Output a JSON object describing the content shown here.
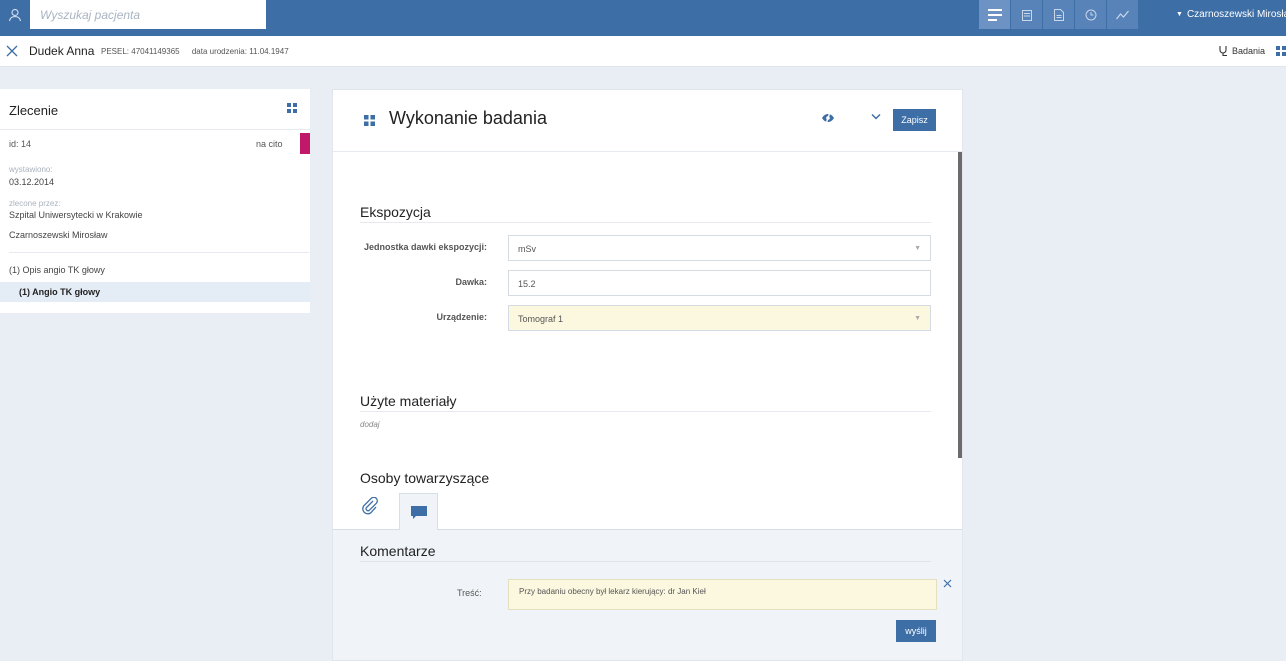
{
  "topbar": {
    "search_placeholder": "Wyszukaj pacjenta",
    "icons": [
      "list-icon",
      "calendar-icon",
      "document-icon",
      "clock-icon",
      "chart-icon"
    ],
    "user": "Czarnoszewski Mirosław"
  },
  "patient": {
    "name": "Dudek Anna",
    "pesel": "PESEL: 47041149365",
    "birth": "data urodzenia: 11.04.1947",
    "badania_label": "Badania"
  },
  "order": {
    "title": "Zlecenie",
    "id": "id: 14",
    "priority": "na cito",
    "issued_label": "wystawiono:",
    "issued_value": "03.12.2014",
    "ordered_by_label": "zlecone przez:",
    "hospital": "Szpital Uniwersytecki w Krakowie",
    "doctor": "Czarnoszewski Mirosław",
    "item": "(1) Opis angio TK głowy",
    "subitem": "(1) Angio TK głowy"
  },
  "exam": {
    "title": "Wykonanie badania",
    "save_label": "Zapisz",
    "exposure": {
      "title": "Ekspozycja",
      "unit_label": "Jednostka dawki ekspozycji:",
      "unit_value": "mSv",
      "dose_label": "Dawka:",
      "dose_value": "15.2",
      "device_label": "Urządzenie:",
      "device_value": "Tomograf 1"
    },
    "materials": {
      "title": "Użyte materiały",
      "add_label": "dodaj"
    },
    "companions": {
      "title": "Osoby towarzyszące"
    }
  },
  "comments": {
    "title": "Komentarze",
    "content_label": "Treść:",
    "content_value": "Przy badaniu obecny był lekarz kierujący: dr Jan Kieł",
    "send_label": "wyślij"
  },
  "colors": {
    "brand": "#3e6ea6",
    "cito": "#c2186a",
    "highlight": "#fcf8df"
  }
}
